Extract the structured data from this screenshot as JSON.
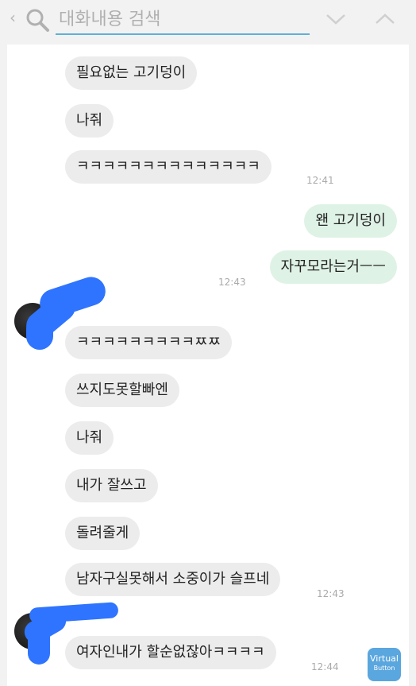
{
  "search": {
    "placeholder": "대화내용 검색"
  },
  "messages": [
    {
      "text": "필요없는 고기덩이",
      "direction": "in"
    },
    {
      "text": "나줘",
      "direction": "in"
    },
    {
      "text": "ㅋㅋㅋㅋㅋㅋㅋㅋㅋㅋㅋㅋㅋㅋ",
      "direction": "in",
      "time": "12:41"
    },
    {
      "text": "왠 고기덩이",
      "direction": "out"
    },
    {
      "text": "자꾸모라는거ㅡㅡ",
      "direction": "out",
      "time": "12:43"
    },
    {
      "text": "ㅋㅋㅋㅋㅋㅋㅋㅋㅋㅉㅉ",
      "direction": "in"
    },
    {
      "text": "쓰지도못할빠엔",
      "direction": "in"
    },
    {
      "text": "나줘",
      "direction": "in"
    },
    {
      "text": "내가 잘쓰고",
      "direction": "in"
    },
    {
      "text": "돌려줄게",
      "direction": "in"
    },
    {
      "text": "남자구실못해서 소중이가 슬프네",
      "direction": "in",
      "time": "12:43"
    },
    {
      "text": "여자인내가 할순없잖아ㅋㅋㅋㅋ",
      "direction": "in",
      "time": "12:44"
    }
  ],
  "virtual_button": {
    "line1": "Virtual",
    "line2": "Button"
  },
  "colors": {
    "incoming_bubble": "#ececec",
    "outgoing_bubble": "#dff2e6",
    "search_underline": "#5fb0d8",
    "redaction_scribble": "#2f74ff",
    "virtual_button": "#5aa6de"
  },
  "icons": [
    "back-chevron-icon",
    "search-icon",
    "chevron-down-icon",
    "chevron-up-icon"
  ]
}
